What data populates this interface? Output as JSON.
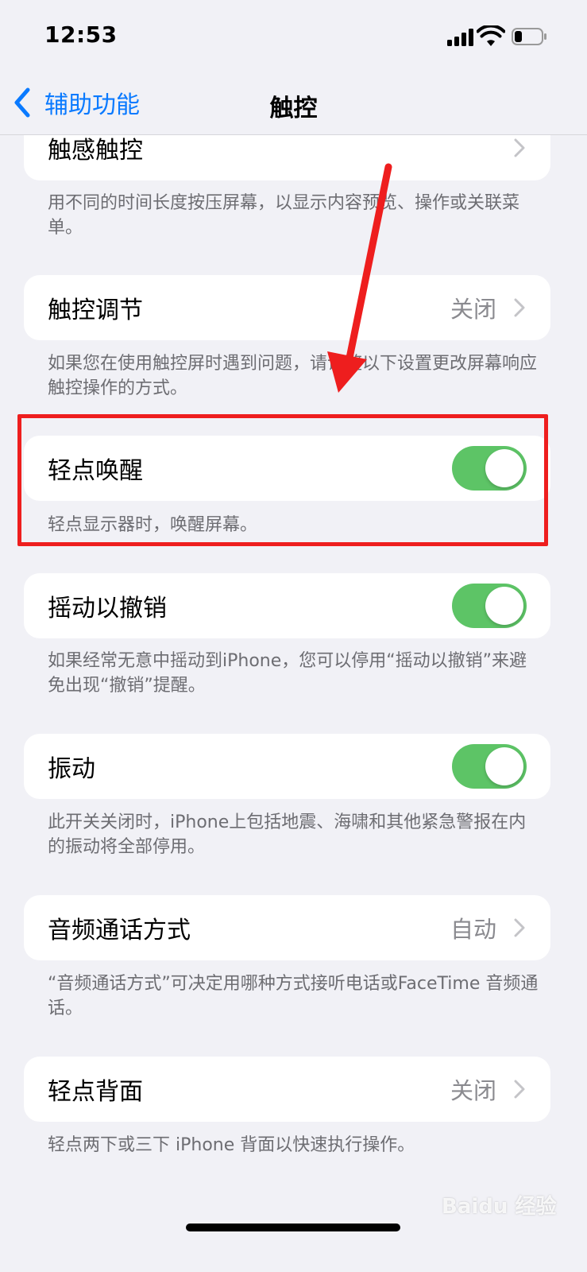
{
  "status_bar": {
    "time": "12:53",
    "signal_icon": "cellular-signal-icon",
    "wifi_icon": "wifi-icon",
    "battery_icon": "battery-icon"
  },
  "nav": {
    "back_label": "辅助功能",
    "title": "触控"
  },
  "rows": [
    {
      "label": "触感触控",
      "type": "chevron",
      "footer": "用不同的时间长度按压屏幕，以显示内容预览、操作或关联菜单。"
    },
    {
      "label": "触控调节",
      "value": "关闭",
      "type": "chevron",
      "footer": "如果您在使用触控屏时遇到问题，请调整以下设置更改屏幕响应触控操作的方式。"
    },
    {
      "label": "轻点唤醒",
      "type": "toggle",
      "on": true,
      "footer": "轻点显示器时，唤醒屏幕。"
    },
    {
      "label": "摇动以撤销",
      "type": "toggle",
      "on": true,
      "footer": "如果经常无意中摇动到iPhone，您可以停用“摇动以撤销”来避免出现“撤销”提醒。"
    },
    {
      "label": "振动",
      "type": "toggle",
      "on": true,
      "footer": "此开关关闭时，iPhone上包括地震、海啸和其他紧急警报在内的振动将全部停用。"
    },
    {
      "label": "音频通话方式",
      "value": "自动",
      "type": "chevron",
      "footer": "“音频通话方式”可决定用哪种方式接听电话或FaceTime 音频通话。"
    },
    {
      "label": "轻点背面",
      "value": "关闭",
      "type": "chevron",
      "footer": "轻点两下或三下 iPhone 背面以快速执行操作。"
    }
  ],
  "colors": {
    "accent": "#0a7aff",
    "toggle_on": "#5dc466",
    "annotation": "#ee1e1e",
    "background": "#f1f1f6"
  },
  "watermark": {
    "text": "Baidu 经验"
  }
}
